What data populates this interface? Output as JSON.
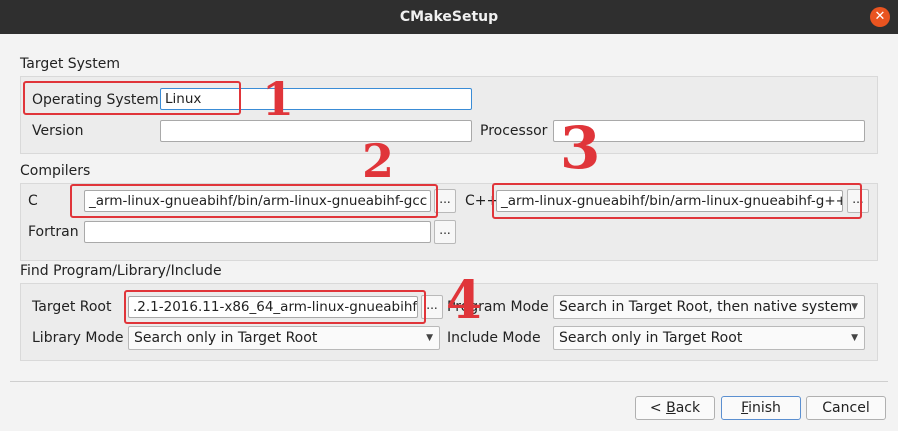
{
  "window": {
    "title": "CMakeSetup",
    "close_icon": "close-icon"
  },
  "target_system": {
    "title": "Target System",
    "os_label": "Operating System",
    "os_value": "Linux",
    "version_label": "Version",
    "version_value": "",
    "processor_label": "Processor",
    "processor_value": ""
  },
  "compilers": {
    "title": "Compilers",
    "c_label": "C",
    "c_value": "_arm-linux-gnueabihf/bin/arm-linux-gnueabihf-gcc",
    "cxx_label": "C++",
    "cxx_value": "_arm-linux-gnueabihf/bin/arm-linux-gnueabihf-g++",
    "fortran_label": "Fortran",
    "fortran_value": "",
    "browse_label": "..."
  },
  "find": {
    "title": "Find Program/Library/Include",
    "target_root_label": "Target Root",
    "target_root_value": ".2.1-2016.11-x86_64_arm-linux-gnueabihf",
    "program_mode_label": "Program Mode",
    "program_mode_value": "Search in Target Root, then native system",
    "library_mode_label": "Library Mode",
    "library_mode_value": "Search only in Target Root",
    "include_mode_label": "Include Mode",
    "include_mode_value": "Search only in Target Root",
    "browse_label": "..."
  },
  "buttons": {
    "back_prefix": "< ",
    "back_mnemonic": "B",
    "back_rest": "ack",
    "finish_mnemonic": "F",
    "finish_rest": "inish",
    "cancel": "Cancel"
  },
  "annotations": [
    "1",
    "2",
    "3",
    "4"
  ],
  "colors": {
    "annotation": "#e0353a",
    "titlebar": "#2f2f2f",
    "close": "#e95420"
  }
}
